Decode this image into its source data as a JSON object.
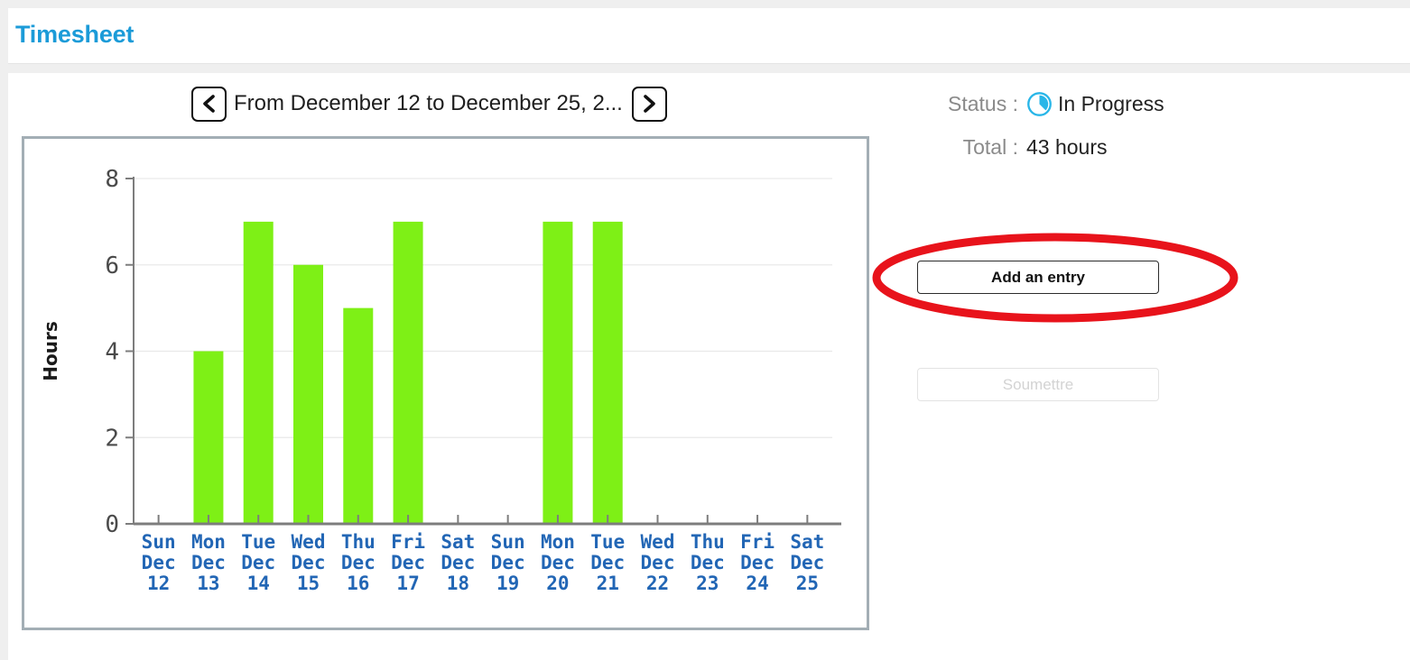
{
  "header": {
    "title": "Timesheet"
  },
  "period_nav": {
    "prev_icon": "chevron-left-icon",
    "next_icon": "chevron-right-icon",
    "label": "From December 12 to December 25, 2..."
  },
  "status_panel": {
    "status_label": "Status :",
    "status_icon": "clock-in-progress-icon",
    "status_value": "In Progress",
    "total_label": "Total :",
    "total_value": "43 hours"
  },
  "actions": {
    "add_entry_label": "Add an entry",
    "submit_label": "Soumettre",
    "submit_disabled": true
  },
  "annotations": {
    "ellipse_color": "#e8131b",
    "rect_color": "#e8131b",
    "highlighted_day": "Wed Dec 22"
  },
  "colors": {
    "title_blue": "#1b9bd8",
    "bar_green": "#7ef016",
    "axis_label_blue": "#2266b5",
    "card_border": "#a3aeb5",
    "status_cyan": "#29b6e8"
  },
  "chart_data": {
    "type": "bar",
    "title": "",
    "xlabel": "",
    "ylabel": "Hours",
    "ylim": [
      0,
      8
    ],
    "yticks": [
      0,
      2,
      4,
      6,
      8
    ],
    "ytick_labels": [
      "0",
      "2",
      "4",
      "6",
      "8"
    ],
    "grid": true,
    "legend": "none",
    "bar_color": "#7ef016",
    "categories": [
      "Sun Dec 12",
      "Mon Dec 13",
      "Tue Dec 14",
      "Wed Dec 15",
      "Thu Dec 16",
      "Fri Dec 17",
      "Sat Dec 18",
      "Sun Dec 19",
      "Mon Dec 20",
      "Tue Dec 21",
      "Wed Dec 22",
      "Thu Dec 23",
      "Fri Dec 24",
      "Sat Dec 25"
    ],
    "tick_lines": [
      [
        "Sun",
        "Dec",
        "12"
      ],
      [
        "Mon",
        "Dec",
        "13"
      ],
      [
        "Tue",
        "Dec",
        "14"
      ],
      [
        "Wed",
        "Dec",
        "15"
      ],
      [
        "Thu",
        "Dec",
        "16"
      ],
      [
        "Fri",
        "Dec",
        "17"
      ],
      [
        "Sat",
        "Dec",
        "18"
      ],
      [
        "Sun",
        "Dec",
        "19"
      ],
      [
        "Mon",
        "Dec",
        "20"
      ],
      [
        "Tue",
        "Dec",
        "21"
      ],
      [
        "Wed",
        "Dec",
        "22"
      ],
      [
        "Thu",
        "Dec",
        "23"
      ],
      [
        "Fri",
        "Dec",
        "24"
      ],
      [
        "Sat",
        "Dec",
        "25"
      ]
    ],
    "values": [
      0,
      4,
      7,
      6,
      5,
      7,
      0,
      0,
      7,
      7,
      0,
      0,
      0,
      0
    ]
  }
}
